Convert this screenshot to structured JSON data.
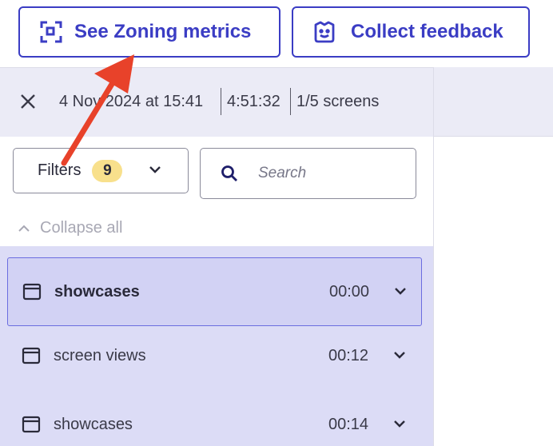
{
  "toolbar": {
    "zoning_button": "See Zoning metrics",
    "feedback_button": "Collect feedback"
  },
  "session": {
    "date": "4 Nov 2024 at 15:41",
    "duration": "4:51:32",
    "screens": "1/5 screens"
  },
  "filters": {
    "label": "Filters",
    "count": "9"
  },
  "search": {
    "placeholder": "Search"
  },
  "collapse_label": "Collapse all",
  "screens_list": [
    {
      "label": "showcases",
      "time": "00:00",
      "active": true
    },
    {
      "label": "screen views",
      "time": "00:12",
      "active": false
    },
    {
      "label": "showcases",
      "time": "00:14",
      "active": false
    }
  ],
  "colors": {
    "accent": "#3b3dc4",
    "annotation_arrow": "#e8422a",
    "list_background": "#dcdcf6",
    "badge": "#f8e08c"
  }
}
